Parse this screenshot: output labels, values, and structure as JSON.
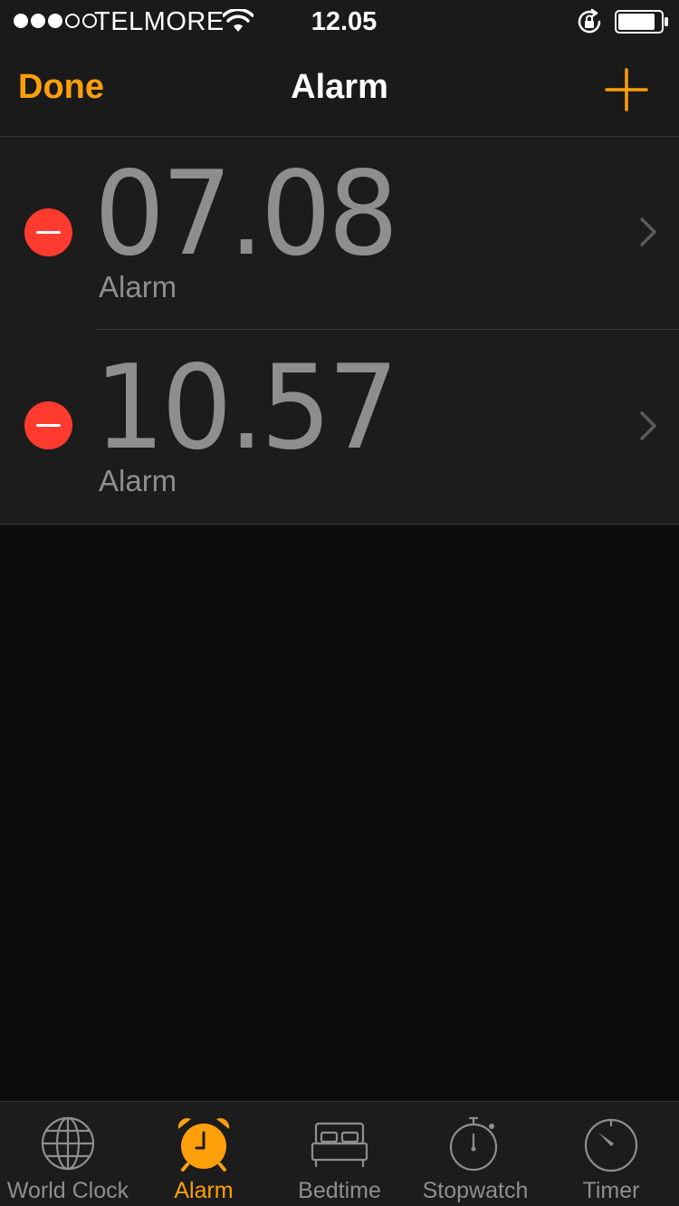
{
  "status_bar": {
    "carrier": "TELMORE",
    "time": "12.05",
    "signal_bars_filled": 3,
    "signal_bars_total": 5
  },
  "nav": {
    "done_label": "Done",
    "title": "Alarm",
    "add_icon": "plus-icon"
  },
  "alarms": [
    {
      "time": "07.08",
      "label": "Alarm"
    },
    {
      "time": "10.57",
      "label": "Alarm"
    }
  ],
  "tabs": [
    {
      "label": "World Clock",
      "icon": "globe-icon",
      "active": false
    },
    {
      "label": "Alarm",
      "icon": "alarm-clock-icon",
      "active": true
    },
    {
      "label": "Bedtime",
      "icon": "bed-icon",
      "active": false
    },
    {
      "label": "Stopwatch",
      "icon": "stopwatch-icon",
      "active": false
    },
    {
      "label": "Timer",
      "icon": "timer-icon",
      "active": false
    }
  ],
  "colors": {
    "accent": "#ff9f0a",
    "delete": "#ff3b30",
    "background": "#0d0d0d",
    "row_background": "#1c1c1c",
    "secondary_text": "#8e8e8e"
  }
}
